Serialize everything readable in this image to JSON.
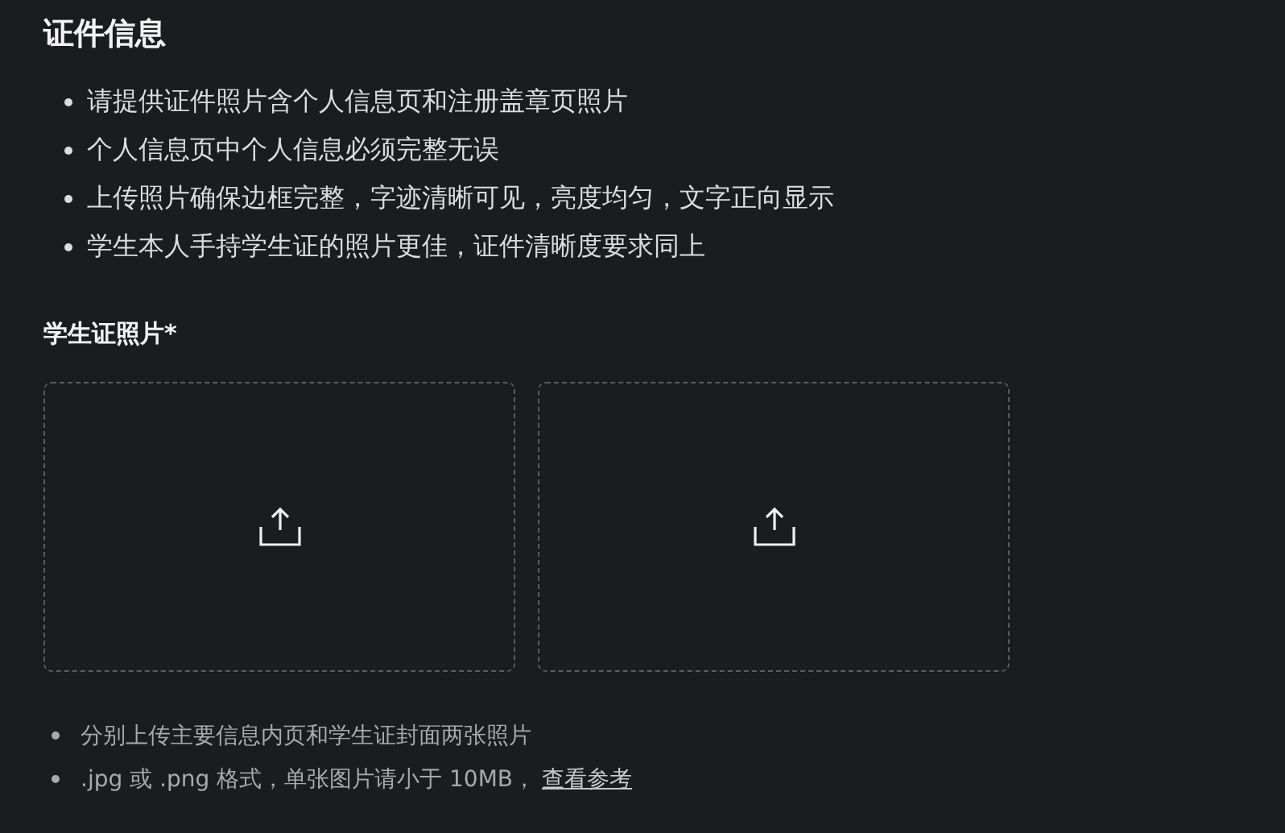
{
  "title": "证件信息",
  "requirements": [
    "请提供证件照片含个人信息页和注册盖章页照片",
    "个人信息页中个人信息必须完整无误",
    "上传照片确保边框完整，字迹清晰可见，亮度均匀，文字正向显示",
    "学生本人手持学生证的照片更佳，证件清晰度要求同上"
  ],
  "upload_section": {
    "label": "学生证照片",
    "required_mark": "*",
    "slots": [
      {
        "kind": "upload"
      },
      {
        "kind": "upload"
      }
    ]
  },
  "hints": [
    {
      "text": "分别上传主要信息内页和学生证封面两张照片"
    },
    {
      "text": ".jpg 或 .png 格式，单张图片请小于 10MB，",
      "link": "查看参考"
    }
  ]
}
